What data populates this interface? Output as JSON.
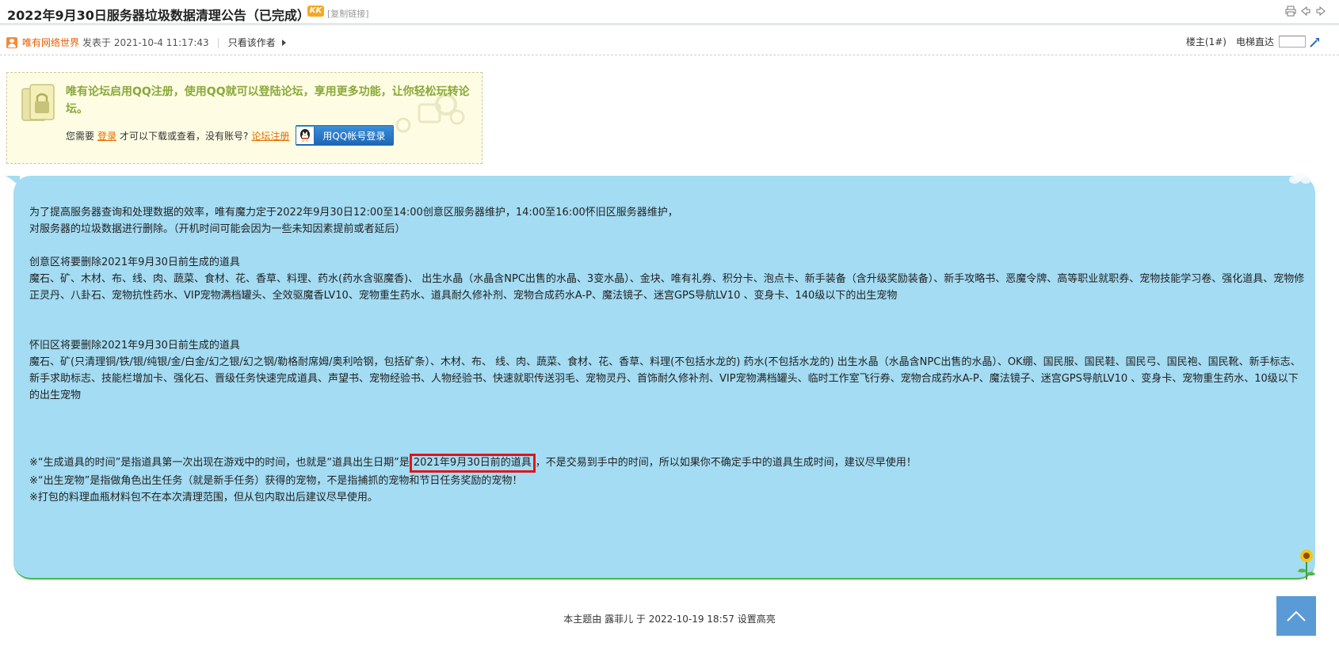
{
  "thread": {
    "title": "2022年9月30日服务器垃圾数据清理公告（已完成）",
    "badge": "KK",
    "copy_link": "[复制链接]"
  },
  "author_bar": {
    "author": "唯有网络世界",
    "posted_at": "发表于 2021-10-4 11:17:43",
    "separator": "|",
    "only_author": "只看该作者",
    "floor": "楼主(1#)",
    "elevator_label": "电梯直达",
    "elevator_value": ""
  },
  "promo": {
    "headline": "唯有论坛启用QQ注册，使用QQ就可以登陆论坛，享用更多功能，让你轻松玩转论坛。",
    "need_prefix": "您需要",
    "login_link": "登录",
    "need_suffix": "才可以下载或查看，没有账号?",
    "register_link": "论坛注册",
    "qq_button": "用QQ帐号登录"
  },
  "post": {
    "intro_1": "为了提高服务器查询和处理数据的效率，唯有魔力定于2022年9月30日12:00至14:00创意区服务器维护，14:00至16:00怀旧区服务器维护，",
    "intro_2": "对服务器的垃圾数据进行删除。（开机时间可能会因为一些未知因素提前或者延后）",
    "creative_heading": "创意区将要删除2021年9月30日前生成的道具",
    "creative_items": "魔石、矿、木材、布、线、肉、蔬菜、食材、花、香草、料理、药水(药水含驱魔香)、 出生水晶（水晶含NPC出售的水晶、3变水晶）、金块、唯有礼券、积分卡、泡点卡、新手装备（含升级奖励装备）、新手攻略书、恶魔令牌、高等职业就职券、宠物技能学习卷、强化道具、宠物修正灵丹、八卦石、宠物抗性药水、VIP宠物满档罐头、全效驱魔香LV10、宠物重生药水、道具耐久修补剂、宠物合成药水A-P、魔法镜子、迷宫GPS导航LV10 、变身卡、140级以下的出生宠物",
    "nostalgic_heading": "怀旧区将要删除2021年9月30日前生成的道具",
    "nostalgic_items": "魔石、矿(只清理铜/铁/银/纯银/金/白金/幻之银/幻之钢/勒格耐席姆/奥利哈钢，包括矿条）、木材、布、 线、肉、蔬菜、食材、花、香草、料理(不包括水龙的) 药水(不包括水龙的) 出生水晶（水晶含NPC出售的水晶）、OK绷、国民服、国民鞋、国民弓、国民袍、国民靴、新手标志、新手求助标志、技能栏增加卡、强化石、晋级任务快速完成道具、声望书、宠物经验书、人物经验书、快速就职传送羽毛、宠物灵丹、首饰耐久修补剂、VIP宠物满档罐头、临时工作室飞行券、宠物合成药水A-P、魔法镜子、迷宫GPS导航LV10 、变身卡、宠物重生药水、10级以下的出生宠物",
    "note_1_prefix": "※“生成道具的时间”是指道具第一次出现在游戏中的时间，也就是“道具出生日期”是",
    "note_1_highlight": "2021年9月30日前的道具",
    "note_1_suffix": "，不是交易到手中的时间，所以如果你不确定手中的道具生成时间，建议尽早使用！",
    "note_2": "※“出生宠物”是指做角色出生任务（就是新手任务）获得的宠物，不是指捕抓的宠物和节日任务奖励的宠物！",
    "note_3": "※打包的料理血瓶材料包不在本次清理范围，但从包内取出后建议尽早使用。"
  },
  "footer": {
    "edit_note": "本主题由 露菲儿 于 2022-10-19 18:57 设置高亮"
  },
  "colors": {
    "post_bg": "#a3dcf3",
    "highlight_border": "#e0141a",
    "promo_headline": "#8aa83a",
    "author_name": "#e65c00",
    "back_top": "#5a9bd5"
  }
}
